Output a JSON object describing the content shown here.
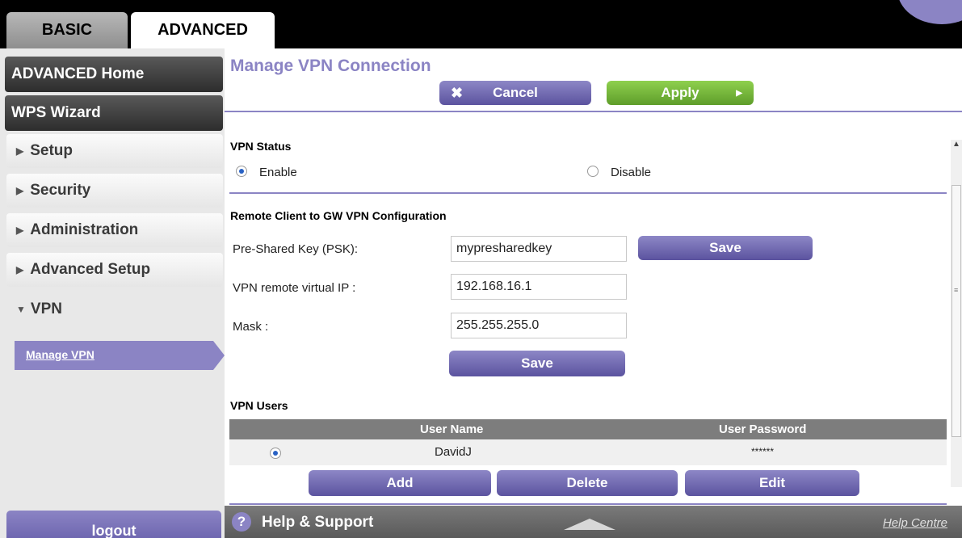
{
  "tabs": {
    "basic": "BASIC",
    "advanced": "ADVANCED"
  },
  "sidebar": {
    "home": "ADVANCED Home",
    "wps": "WPS Wizard",
    "items": [
      "Setup",
      "Security",
      "Administration",
      "Advanced Setup"
    ],
    "vpn": "VPN",
    "manage_vpn": "Manage VPN",
    "logout": "logout"
  },
  "main": {
    "title": "Manage VPN Connection",
    "cancel": "Cancel",
    "apply": "Apply",
    "vpn_status": {
      "label": "VPN Status",
      "enable": "Enable",
      "disable": "Disable",
      "selected": "Enable"
    },
    "config": {
      "label": "Remote Client to GW VPN Configuration",
      "psk_label": "Pre-Shared Key (PSK):",
      "psk_value": "mypresharedkey",
      "save_psk": "Save",
      "virtual_ip_label": "VPN remote virtual IP :",
      "virtual_ip_value": "192.168.16.1",
      "mask_label": "Mask :",
      "mask_value": "255.255.255.0",
      "save": "Save"
    },
    "users": {
      "label": "VPN Users",
      "col_name": "User Name",
      "col_password": "User Password",
      "rows": [
        {
          "name": "DavidJ",
          "password": "******"
        }
      ],
      "add": "Add",
      "delete": "Delete",
      "edit": "Edit"
    }
  },
  "help": {
    "title": "Help & Support",
    "centre": "Help Centre"
  },
  "colors": {
    "accent": "#8b84c4",
    "apply_green": "#74b83a",
    "sidebar_dark": "#3f3f3f"
  },
  "icons": {
    "cancel": "close-icon",
    "apply": "play-arrow-icon",
    "help": "question-icon",
    "expand": "chevron-up-icon"
  }
}
